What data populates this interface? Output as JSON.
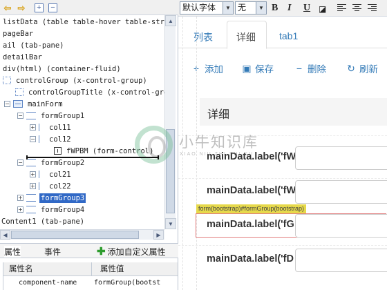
{
  "left_toolbar": {
    "icons": [
      "arrow-left-icon",
      "arrow-right-icon",
      "expand-all-icon",
      "collapse-all-icon"
    ]
  },
  "tree": {
    "items": [
      {
        "label": "listData (table table-hover table-strip",
        "icon": "list-icon"
      },
      {
        "label": "pageBar",
        "icon": "none"
      },
      {
        "label": "ail (tab-pane)",
        "icon": "none"
      },
      {
        "label": "detailBar",
        "icon": "none"
      },
      {
        "label": "div(html) (container-fluid)",
        "icon": "none"
      },
      {
        "label": "controlGroup (x-control-group)",
        "icon": "list-icon"
      },
      {
        "label": "controlGroupTitle (x-control-grou",
        "icon": "list-icon"
      },
      {
        "label": "mainForm",
        "icon": "form-icon",
        "expander": "−"
      },
      {
        "label": "formGroup1",
        "icon": "group-icon",
        "expander": "−"
      },
      {
        "label": "col11",
        "icon": "column-icon",
        "expander": "+"
      },
      {
        "label": "col12",
        "icon": "column-icon",
        "expander": "−"
      },
      {
        "label": "fWPBM (form-control)",
        "icon": "control-icon"
      },
      {
        "label": "formGroup2",
        "icon": "group-icon",
        "expander": "−"
      },
      {
        "label": "col21",
        "icon": "column-icon",
        "expander": "+"
      },
      {
        "label": "col22",
        "icon": "column-icon",
        "expander": "+"
      },
      {
        "label": "formGroup3",
        "icon": "group-icon",
        "expander": "+",
        "selected": true
      },
      {
        "label": "formGroup4",
        "icon": "group-icon",
        "expander": "+"
      },
      {
        "label": "Content1 (tab-pane)",
        "icon": "none"
      }
    ]
  },
  "props": {
    "tabs": [
      "属性",
      "事件"
    ],
    "add_button": "添加自定义属性",
    "col_name": "属性名",
    "col_value": "属性值",
    "rows": [
      {
        "name": "component-name",
        "value": "formGroup(bootst"
      }
    ]
  },
  "right_toolbar": {
    "font_family": "默认字体",
    "font_size": "无",
    "bold": "B",
    "italic": "I",
    "underline": "U"
  },
  "design": {
    "tabs": [
      "列表",
      "详细",
      "tab1"
    ],
    "active_tab": "详细",
    "actions": [
      {
        "icon": "plus-icon",
        "label": "添加"
      },
      {
        "icon": "save-icon",
        "label": "保存"
      },
      {
        "icon": "minus-icon",
        "label": "删除"
      },
      {
        "icon": "refresh-icon",
        "label": "刷新"
      }
    ],
    "section_title": "详细",
    "form_rows": [
      {
        "label": "mainData.label('fW"
      },
      {
        "label": "mainData.label('fW"
      },
      {
        "label": "mainData.label('fG"
      },
      {
        "label": "mainData.label('fD"
      }
    ],
    "selection_tag": "form(bootstrap)#formGroup(bootstrap)"
  },
  "watermark": {
    "text": "小牛知识库",
    "subtext": "XIAO NIU ZHI SHI KU"
  },
  "colors": {
    "selection": "#3169c6",
    "link": "#337ab7",
    "tag_bg": "#e6d94b",
    "selected_row_border": "#e27b7b"
  }
}
